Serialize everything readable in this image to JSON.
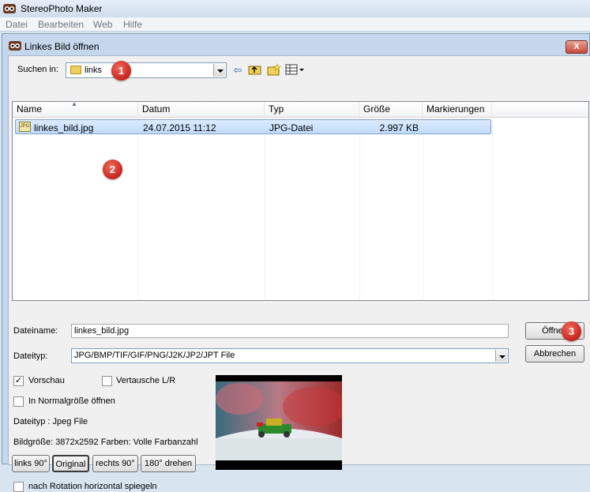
{
  "app": {
    "title": "StereoPhoto Maker"
  },
  "menu": [
    "Datei",
    "Bearbeiten",
    "Web",
    "Hilfe"
  ],
  "dialog": {
    "title": "Linkes Bild öffnen",
    "close_label": "X",
    "lookin": {
      "label": "Suchen in:",
      "value": "links"
    },
    "toolbar_icons": [
      "back-icon",
      "up-folder-icon",
      "new-folder-icon",
      "view-menu-icon"
    ],
    "columns": [
      "Name",
      "Datum",
      "Typ",
      "Größe",
      "Markierungen"
    ],
    "files": [
      {
        "name": "linkes_bild.jpg",
        "date": "24.07.2015 11:12",
        "type": "JPG-Datei",
        "size": "2.997 KB",
        "tags": ""
      }
    ],
    "filename": {
      "label": "Dateiname:",
      "value": "linkes_bild.jpg"
    },
    "filetype": {
      "label": "Dateityp:",
      "value": "JPG/BMP/TIF/GIF/PNG/J2K/JP2/JPT File"
    },
    "buttons": {
      "open": "Öffnen",
      "cancel": "Abbrechen"
    },
    "options": {
      "preview": {
        "label": "Vorschau",
        "checked": true
      },
      "swap": {
        "label": "Vertausche L/R",
        "checked": false
      },
      "normal_size": {
        "label": "In Normalgröße öffnen",
        "checked": false
      },
      "mirror": {
        "label": "nach Rotation horizontal spiegeln",
        "checked": false
      }
    },
    "info": {
      "filetype": "Dateityp : Jpeg File",
      "imagesize": "Bildgröße: 3872x2592  Farben: Volle Farbanzahl"
    },
    "rotate_buttons": [
      "links 90°",
      "Original",
      "rechts 90°",
      "180° drehen"
    ]
  },
  "annotations": [
    "1",
    "2",
    "3"
  ],
  "colors": {
    "selection": "#c9e0fc",
    "badge": "#d8322a",
    "close": "#c8473a"
  }
}
